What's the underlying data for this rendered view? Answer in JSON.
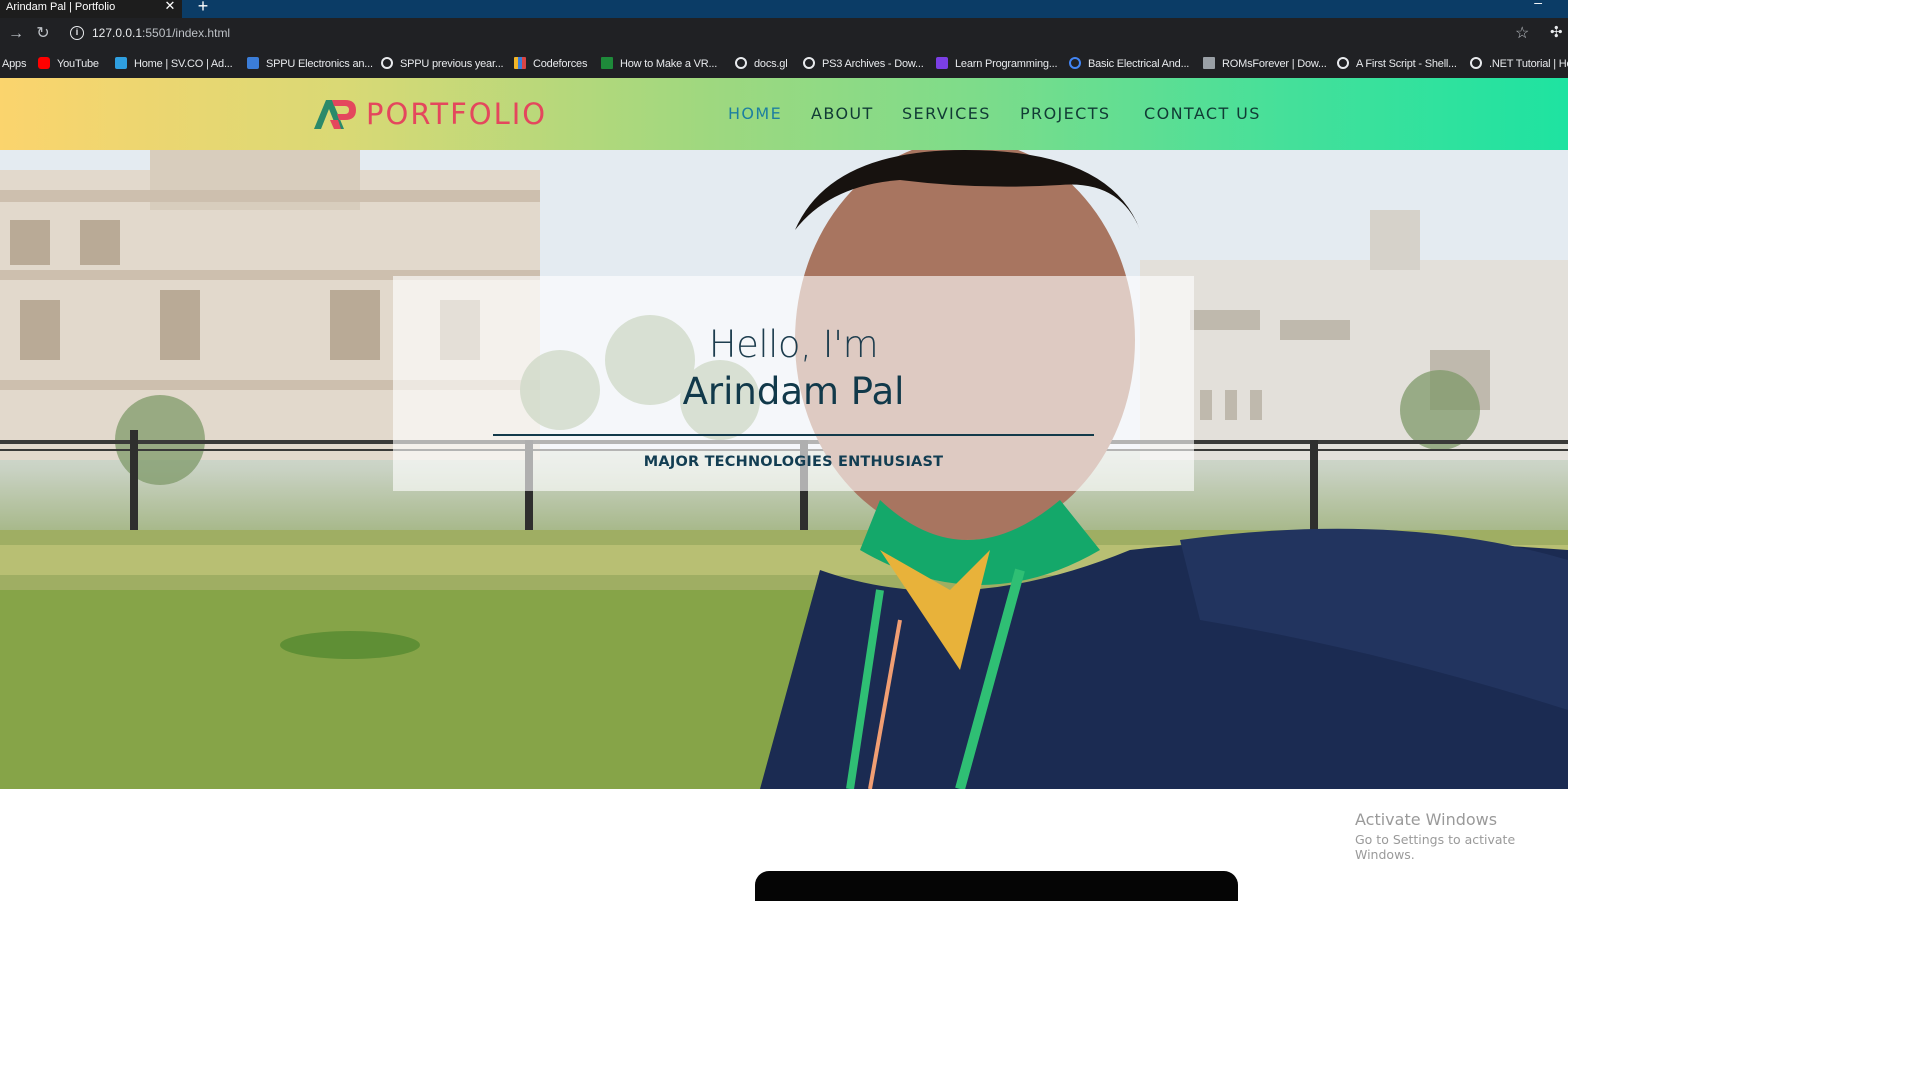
{
  "browser": {
    "tab_title": "Arindam Pal | Portfolio",
    "tab_close": "✕",
    "new_tab": "+",
    "url_host": "127.0.0.1",
    "url_rest": ":5501/index.html",
    "bookmarks": [
      {
        "label": "Apps",
        "icon": "apps-grid-icon",
        "color": ""
      },
      {
        "label": "YouTube",
        "icon": "youtube-icon",
        "color": "#ff0000"
      },
      {
        "label": "Home | SV.CO | Ad...",
        "icon": "svco-icon",
        "color": "#2f9fe0"
      },
      {
        "label": "SPPU Electronics an...",
        "icon": "sppu-icon",
        "color": "#3b7dd8"
      },
      {
        "label": "SPPU previous year...",
        "icon": "globe-icon",
        "color": "#e8eaed"
      },
      {
        "label": "Codeforces",
        "icon": "codeforces-icon",
        "color": "#f0b429"
      },
      {
        "label": "How to Make a VR...",
        "icon": "chart-icon",
        "color": "#1e8a3a"
      },
      {
        "label": "docs.gl",
        "icon": "globe-icon",
        "color": "#e8eaed"
      },
      {
        "label": "PS3 Archives - Dow...",
        "icon": "globe-icon",
        "color": "#e8eaed"
      },
      {
        "label": "Learn Programming...",
        "icon": "learn-icon",
        "color": "#7b3fe4"
      },
      {
        "label": "Basic Electrical And...",
        "icon": "google-icon",
        "color": "#4285f4"
      },
      {
        "label": "ROMsForever | Dow...",
        "icon": "file-icon",
        "color": "#9aa0a6"
      },
      {
        "label": "A First Script - Shell...",
        "icon": "globe-icon",
        "color": "#e8eaed"
      },
      {
        "label": ".NET Tutorial | He",
        "icon": "globe-icon",
        "color": "#e8eaed"
      }
    ]
  },
  "header": {
    "logo_text": "PORTFOLIO",
    "nav": [
      "HOME",
      "ABOUT",
      "SERVICES",
      "PROJECTS",
      "CONTACT US"
    ],
    "active_index": 0
  },
  "hero": {
    "greeting": "Hello, I'm",
    "name": "Arindam Pal",
    "tagline": "MAJOR TECHNOLOGIES ENTHUSIAST"
  },
  "watermark": {
    "title": "Activate Windows",
    "subtitle": "Go to Settings to activate Windows."
  },
  "colors": {
    "logo_text": "#e4475d",
    "nav_text": "#113b35",
    "nav_active": "#1d7fa0",
    "header_gradient_start": "#fbd46d",
    "header_gradient_end": "#1ee3a1"
  }
}
